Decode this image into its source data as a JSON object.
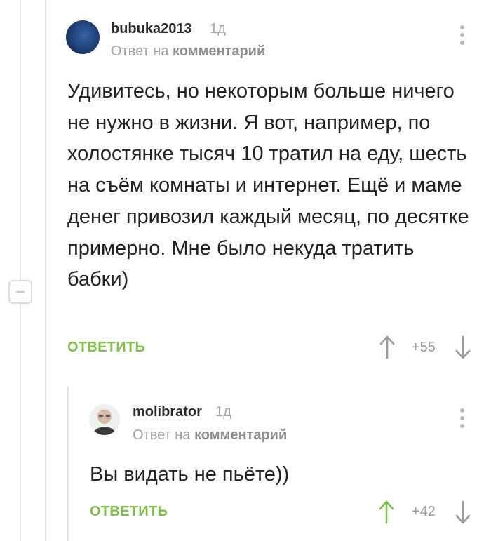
{
  "main_comment": {
    "username": "bubuka2013",
    "time": "1д",
    "reply_prefix": "Ответ на",
    "reply_target": "комментарий",
    "text": "Удивитесь, но некоторым больше ничего не нужно в жизни. Я вот, например, по холостянке тысяч 10 тратил на еду, шесть на съём комнаты и интернет. Ещё и маме денег привозил каждый месяц, по десятке примерно. Мне было некуда тратить бабки)",
    "reply_label": "ОТВЕТИТЬ",
    "score": "+55",
    "upvote_color": "#9a9a9a"
  },
  "reply_comment": {
    "username": "molibrator",
    "time": "1д",
    "reply_prefix": "Ответ на",
    "reply_target": "комментарий",
    "text": "Вы видать не пьёте))",
    "reply_label": "ОТВЕТИТЬ",
    "score": "+42",
    "upvote_color": "#7fbf4a"
  },
  "colors": {
    "accent_green": "#7fbf4a",
    "thread_line": "#e4e4e4"
  }
}
